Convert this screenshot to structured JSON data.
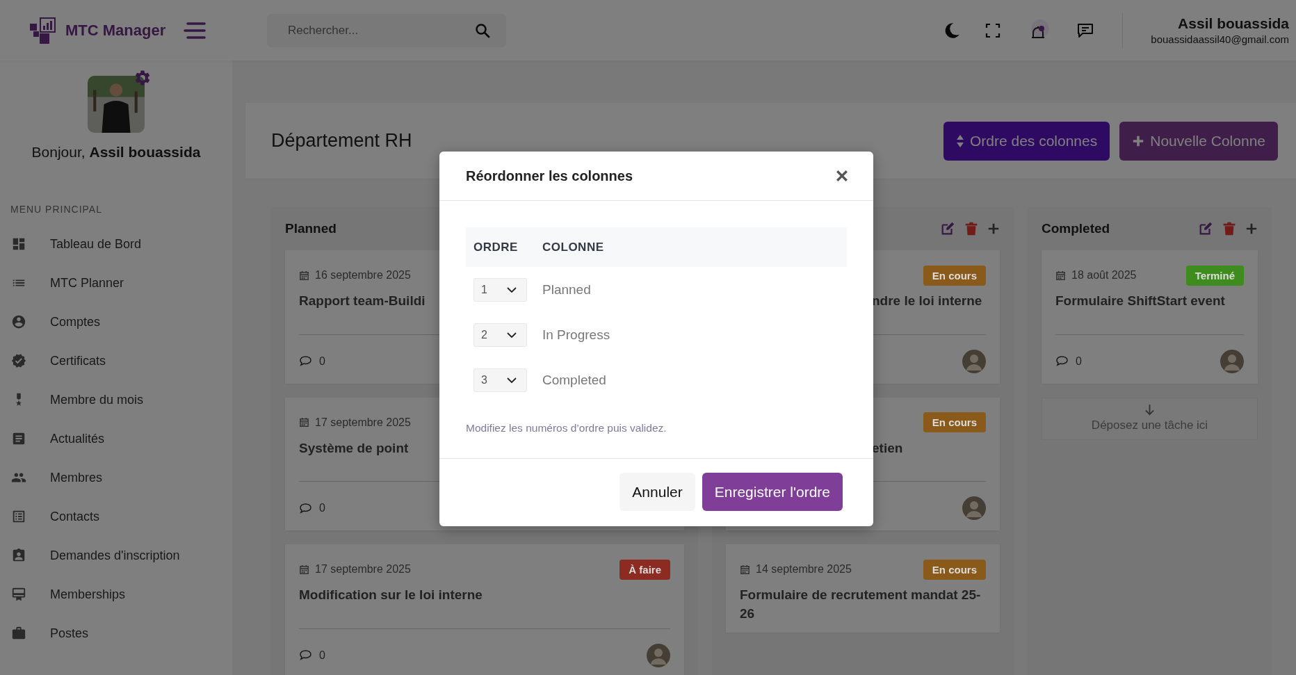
{
  "brand": {
    "name": "MTC Manager"
  },
  "search": {
    "placeholder": "Rechercher..."
  },
  "user": {
    "name": "Assil bouassida",
    "email": "bouassidaassil40@gmail.com"
  },
  "profile": {
    "greeting": "Bonjour, **Assil bouassida**"
  },
  "sidebar": {
    "heading": "MENU PRINCIPAL",
    "items": [
      {
        "label": "Tableau de Bord",
        "kind": "dashboard"
      },
      {
        "label": "MTC Planner",
        "kind": "list"
      },
      {
        "label": "Comptes",
        "kind": "account"
      },
      {
        "label": "Certificats",
        "kind": "verified"
      },
      {
        "label": "Membre du mois",
        "kind": "medal"
      },
      {
        "label": "Actualités",
        "kind": "article"
      },
      {
        "label": "Membres",
        "kind": "group"
      },
      {
        "label": "Contacts",
        "kind": "checklist"
      },
      {
        "label": "Demandes d'inscription",
        "kind": "idcard"
      },
      {
        "label": "Memberships",
        "kind": "membership"
      },
      {
        "label": "Postes",
        "kind": "work"
      }
    ]
  },
  "page": {
    "title": "Département RH",
    "buttons": [
      {
        "label": "Ordre des colonnes",
        "kind": "order"
      },
      {
        "label": "Nouvelle Colonne",
        "kind": "add"
      }
    ]
  },
  "columns": [
    {
      "title": "Planned",
      "cards": [
        {
          "kind": "plain",
          "date": "16 septembre 2025",
          "title": "Rapport team-Buildi",
          "comments": "0"
        },
        {
          "kind": "plain",
          "date": "17 septembre 2025",
          "title": "Système de point",
          "comments": "0"
        },
        {
          "kind": "plain",
          "date": "17 septembre 2025",
          "title": "Modification sur le loi interne",
          "badge": {
            "label": "À faire",
            "color": "#8b2b22"
          },
          "comments": "0",
          "avatar": true
        }
      ]
    },
    {
      "header_icons": true,
      "cards": [
        {
          "kind": "cut-left",
          "title": "ndre le loi interne",
          "badge": {
            "label": "En cours",
            "color": "#8a5a1a"
          },
          "avatar": true
        },
        {
          "kind": "cut-left",
          "title": "etien",
          "badge": {
            "label": "En cours",
            "color": "#8a5a1a"
          },
          "avatar": true
        },
        {
          "kind": "plain",
          "date": "14 septembre 2025",
          "title": "Formulaire de recrutement mandat 25-26",
          "badge": {
            "label": "En cours",
            "color": "#8a5a1a"
          }
        }
      ]
    },
    {
      "title": "Completed",
      "header_icons": true,
      "cards": [
        {
          "kind": "plain",
          "date": "18 août 2025",
          "title": "Formulaire ShiftStart event",
          "badge": {
            "label": "Terminé",
            "color": "#3f8c1e"
          },
          "comments": "0",
          "avatar": true
        }
      ],
      "drop_hint": "Déposez une tâche ici"
    }
  ],
  "modal": {
    "title": "Réordonner les colonnes",
    "columns": [
      "ORDRE",
      "COLONNE"
    ],
    "rows": [
      {
        "order": "1",
        "name": "Planned"
      },
      {
        "order": "2",
        "name": "In Progress"
      },
      {
        "order": "3",
        "name": "Completed"
      }
    ],
    "hint": "Modifiez les numéros d’ordre puis validez.",
    "buttons": [
      {
        "label": "Annuler",
        "kind": "secondary"
      },
      {
        "label": "Enregistrer l'ordre",
        "kind": "primary"
      }
    ]
  }
}
